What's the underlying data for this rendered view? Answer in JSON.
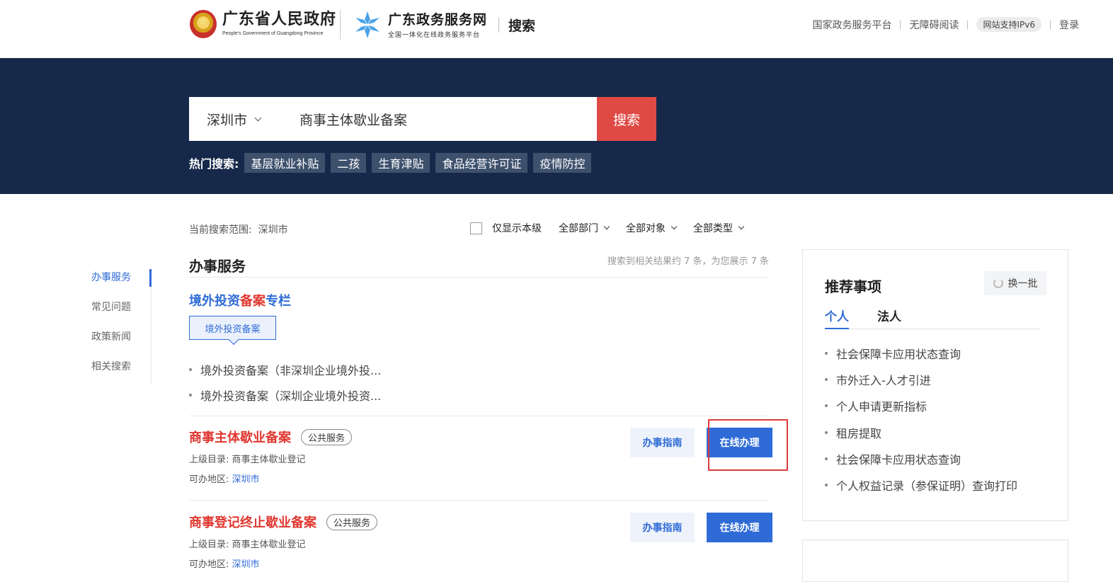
{
  "header": {
    "gov_name": "广东省人民政府",
    "gov_name_en": "People's Government of Guangdong Province",
    "service_name": "广东政务服务网",
    "service_sub": "全国一体化在线政务服务平台",
    "page_title": "搜索",
    "links": [
      "国家政务服务平台",
      "无障碍阅读",
      "网站支持IPv6",
      "登录"
    ]
  },
  "search": {
    "city": "深圳市",
    "query": "商事主体歇业备案",
    "button": "搜索",
    "hot_label": "热门搜索:",
    "hot_tags": [
      "基层就业补贴",
      "二孩",
      "生育津贴",
      "食品经营许可证",
      "疫情防控"
    ]
  },
  "sidebar": {
    "items": [
      "办事服务",
      "常见问题",
      "政策新闻",
      "相关搜索"
    ]
  },
  "filters": {
    "scope_label": "当前搜索范围:",
    "scope_value": "深圳市",
    "only_this_level": "仅显示本级",
    "department": "全部部门",
    "target": "全部对象",
    "type": "全部类型"
  },
  "results": {
    "section_title": "办事服务",
    "count_text": "搜索到相关结果约 7 条，为您展示 7 条",
    "column": {
      "title_a": "境外投资",
      "title_b": "备案",
      "title_c": "专栏",
      "tab": "境外投资备案",
      "items": [
        "境外投资备案（非深圳企业境外投...",
        "境外投资备案（深圳企业境外投资..."
      ]
    },
    "items": [
      {
        "name": "商事主体歇业备案",
        "badge": "公共服务",
        "parent_label": "上级目录:",
        "parent": "商事主体歇业登记",
        "region_label": "可办地区:",
        "region": "深圳市",
        "guide": "办事指南",
        "online": "在线办理"
      },
      {
        "name_a": "商事",
        "name_b": "登记终止",
        "name_c": "歇业备案",
        "badge": "公共服务",
        "parent_label": "上级目录:",
        "parent": "商事主体歇业登记",
        "region_label": "可办地区:",
        "region": "深圳市",
        "guide": "办事指南",
        "online": "在线办理"
      }
    ]
  },
  "recommend": {
    "title": "推荐事项",
    "swap": "换一批",
    "tabs": [
      "个人",
      "法人"
    ],
    "items": [
      "社会保障卡应用状态查询",
      "市外迁入-人才引进",
      "个人申请更新指标",
      "租房提取",
      "社会保障卡应用状态查询",
      "个人权益记录（参保证明）查询打印"
    ]
  },
  "colors": {
    "navy": "#16294a",
    "accent_blue": "#2f6bd6",
    "accent_red": "#e04a45"
  }
}
